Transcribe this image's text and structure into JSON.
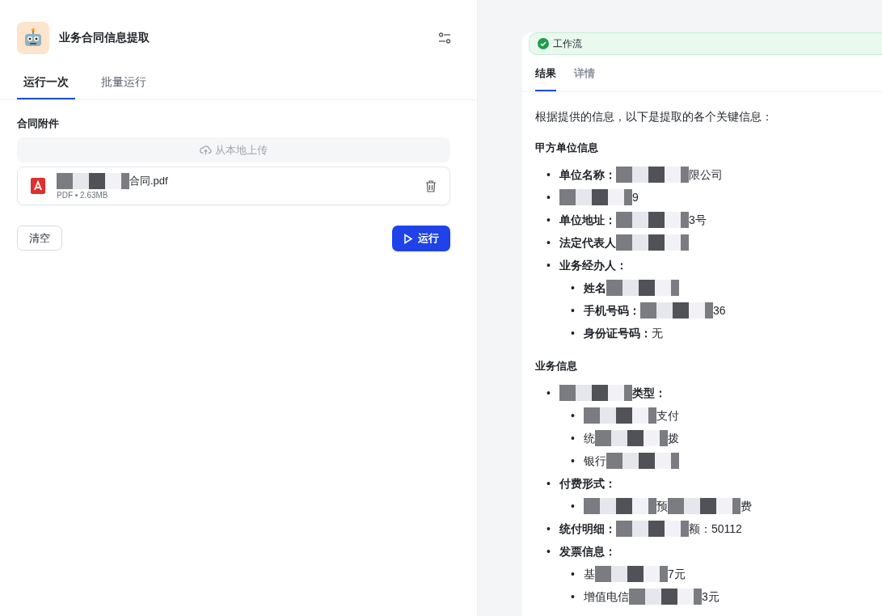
{
  "app": {
    "title": "业务合同信息提取"
  },
  "tabs": [
    {
      "label": "运行一次",
      "selected": true
    },
    {
      "label": "批量运行",
      "selected": false
    }
  ],
  "form": {
    "field_label": "合同附件",
    "upload_button": "从本地上传",
    "file": {
      "name_parts": [
        {
          "kind": "redacted"
        },
        {
          "kind": "text",
          "text": "合同.pdf"
        }
      ],
      "meta": "PDF • 2.63MB"
    },
    "clear_button": "清空",
    "run_button": "运行"
  },
  "result": {
    "status": {
      "label": "工作流",
      "done": true
    },
    "tabs": [
      {
        "label": "结果",
        "selected": true
      },
      {
        "label": "详情",
        "selected": false
      }
    ],
    "intro": "根据提供的信息，以下是提取的各个关键信息：",
    "sections": [
      {
        "heading": "甲方单位信息",
        "items": [
          {
            "marker": "•",
            "parts": [
              {
                "kind": "bold",
                "text": "单位名称："
              },
              {
                "kind": "redacted"
              },
              {
                "kind": "text",
                "text": "限公司"
              }
            ]
          },
          {
            "marker": "•",
            "parts": [
              {
                "kind": "redacted"
              },
              {
                "kind": "text",
                "text": "9"
              }
            ]
          },
          {
            "marker": "•",
            "parts": [
              {
                "kind": "bold",
                "text": "单位地址："
              },
              {
                "kind": "redacted"
              },
              {
                "kind": "text",
                "text": "3号"
              }
            ]
          },
          {
            "marker": "•",
            "parts": [
              {
                "kind": "bold",
                "text": "法定代表人"
              },
              {
                "kind": "redacted"
              }
            ]
          },
          {
            "marker": "•",
            "parts": [
              {
                "kind": "bold",
                "text": "业务经办人："
              }
            ],
            "children": [
              {
                "marker": "•",
                "parts": [
                  {
                    "kind": "bold",
                    "text": "姓名"
                  },
                  {
                    "kind": "redacted"
                  }
                ]
              },
              {
                "marker": "•",
                "parts": [
                  {
                    "kind": "bold",
                    "text": "手机号码："
                  },
                  {
                    "kind": "redacted"
                  },
                  {
                    "kind": "text",
                    "text": "36"
                  }
                ]
              },
              {
                "marker": "•",
                "parts": [
                  {
                    "kind": "bold",
                    "text": "身份证号码："
                  },
                  {
                    "kind": "text",
                    "text": "无"
                  }
                ]
              }
            ]
          }
        ]
      },
      {
        "heading": "业务信息",
        "items": [
          {
            "marker": "•",
            "parts": [
              {
                "kind": "redacted"
              },
              {
                "kind": "bold",
                "text": "类型："
              }
            ],
            "children": [
              {
                "marker": "•",
                "parts": [
                  {
                    "kind": "redacted"
                  },
                  {
                    "kind": "text",
                    "text": "支付"
                  }
                ]
              },
              {
                "marker": "•",
                "parts": [
                  {
                    "kind": "text",
                    "text": "统"
                  },
                  {
                    "kind": "redacted"
                  },
                  {
                    "kind": "text",
                    "text": "拨"
                  }
                ]
              },
              {
                "marker": "•",
                "parts": [
                  {
                    "kind": "text",
                    "text": "银行"
                  },
                  {
                    "kind": "redacted"
                  }
                ]
              }
            ]
          },
          {
            "marker": "•",
            "parts": [
              {
                "kind": "bold",
                "text": "付费形式："
              }
            ],
            "children": [
              {
                "marker": "•",
                "parts": [
                  {
                    "kind": "redacted"
                  },
                  {
                    "kind": "text",
                    "text": "预"
                  },
                  {
                    "kind": "redacted"
                  },
                  {
                    "kind": "text",
                    "text": "费"
                  }
                ]
              }
            ]
          },
          {
            "marker": "•",
            "parts": [
              {
                "kind": "bold",
                "text": "统付明细："
              },
              {
                "kind": "redacted"
              },
              {
                "kind": "text",
                "text": "额：50112"
              }
            ]
          },
          {
            "marker": "•",
            "parts": [
              {
                "kind": "bold",
                "text": "发票信息："
              }
            ],
            "children": [
              {
                "marker": "•",
                "parts": [
                  {
                    "kind": "text",
                    "text": "基"
                  },
                  {
                    "kind": "redacted"
                  },
                  {
                    "kind": "text",
                    "text": "7元"
                  }
                ]
              },
              {
                "marker": "•",
                "parts": [
                  {
                    "kind": "text",
                    "text": "增值电信"
                  },
                  {
                    "kind": "redacted"
                  },
                  {
                    "kind": "text",
                    "text": "3元"
                  }
                ]
              }
            ]
          }
        ]
      }
    ]
  }
}
